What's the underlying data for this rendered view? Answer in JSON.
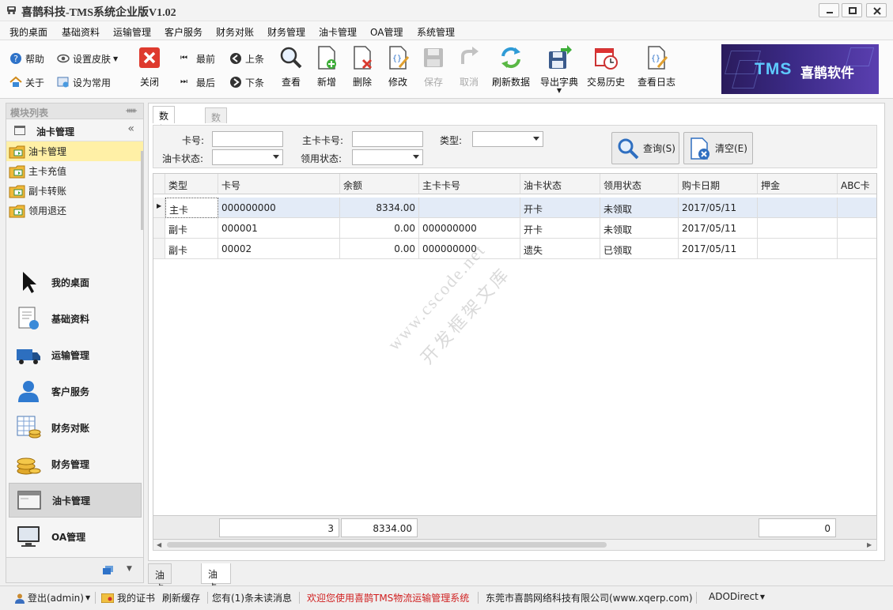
{
  "window": {
    "title": "喜鹊科技-TMS系统企业版V1.02"
  },
  "menu": [
    "我的桌面",
    "基础资料",
    "运输管理",
    "客户服务",
    "财务对账",
    "财务管理",
    "油卡管理",
    "OA管理",
    "系统管理"
  ],
  "toolbar": {
    "help": "帮助",
    "skin": "设置皮肤",
    "about": "关于",
    "favorite": "设为常用",
    "close": "关闭",
    "first": "最前",
    "last": "最后",
    "prev": "上条",
    "next": "下条",
    "view": "查看",
    "add": "新增",
    "delete": "删除",
    "edit": "修改",
    "save": "保存",
    "cancel": "取消",
    "refresh": "刷新数据",
    "export": "导出字典",
    "history": "交易历史",
    "log": "查看日志"
  },
  "banner": {
    "tms": "TMS",
    "brand": "喜鹊软件"
  },
  "sidebar": {
    "header": "模块列表",
    "group": "油卡管理",
    "items": [
      "油卡管理",
      "主卡充值",
      "副卡转账",
      "领用退还"
    ],
    "nav": [
      "我的桌面",
      "基础资料",
      "运输管理",
      "客户服务",
      "财务对账",
      "财务管理",
      "油卡管理",
      "OA管理"
    ]
  },
  "main": {
    "tabs": [
      "数据查询",
      "数据编辑"
    ],
    "query": {
      "card_no": "卡号:",
      "main_card_no": "主卡卡号:",
      "type": "类型:",
      "card_status": "油卡状态:",
      "claim_status": "领用状态:",
      "search_btn": "查询(S)",
      "clear_btn": "清空(E)"
    },
    "grid": {
      "columns": [
        "类型",
        "卡号",
        "余额",
        "主卡卡号",
        "油卡状态",
        "领用状态",
        "购卡日期",
        "押金",
        "ABC卡"
      ],
      "rows": [
        {
          "type": "主卡",
          "card": "000000000",
          "balance": "8334.00",
          "main": "",
          "status": "开卡",
          "claim": "未领取",
          "date": "2017/05/11",
          "deposit": "",
          "abc": ""
        },
        {
          "type": "副卡",
          "card": "000001",
          "balance": "0.00",
          "main": "000000000",
          "status": "开卡",
          "claim": "未领取",
          "date": "2017/05/11",
          "deposit": "",
          "abc": ""
        },
        {
          "type": "副卡",
          "card": "00002",
          "balance": "0.00",
          "main": "000000000",
          "status": "遗失",
          "claim": "已领取",
          "date": "2017/05/11",
          "deposit": "",
          "abc": ""
        }
      ],
      "footer": {
        "count": "3",
        "balance_sum": "8334.00",
        "deposit_sum": "0"
      }
    }
  },
  "bottom_tabs": [
    "油卡管理",
    "油卡管理"
  ],
  "watermark": {
    "line1": "www.cscode.net",
    "line2": "开发框架文库"
  },
  "status": {
    "login": "登出(admin)",
    "cert": "我的证书",
    "refresh": "刷新缓存",
    "messages": "您有(1)条未读消息",
    "welcome": "欢迎您使用喜鹊TMS物流运输管理系统",
    "company": "东莞市喜鹊网络科技有限公司(www.xqerp.com)",
    "db": "ADODirect"
  },
  "colors": {
    "accent": "#d33b2c",
    "selection": "#fff0a6",
    "grid_selected": "#e3ebf7",
    "welcome_text": "#d01f1f"
  }
}
